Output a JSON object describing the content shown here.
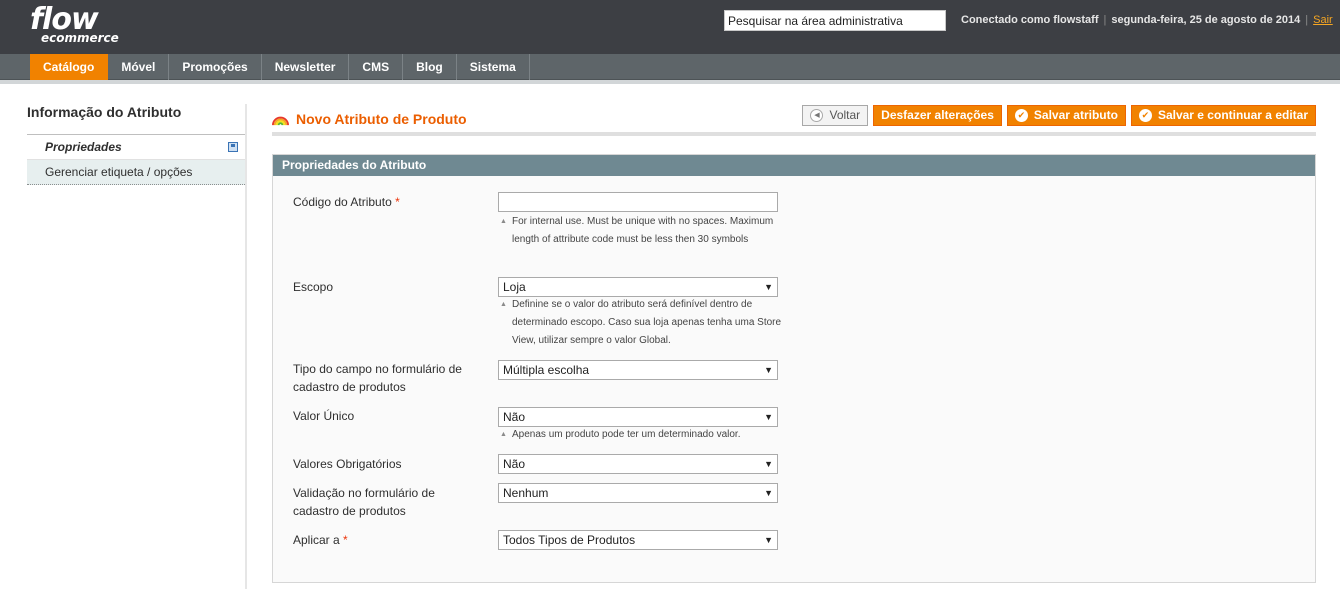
{
  "header": {
    "logo_line1": "flow",
    "logo_line2": "ecommerce",
    "search_value": "Pesquisar na área administrativa",
    "logged_in": "Conectado como flowstaff",
    "date": "segunda-feira, 25 de agosto de 2014",
    "logout": "Sair"
  },
  "nav": {
    "items": [
      "Catálogo",
      "Móvel",
      "Promoções",
      "Newsletter",
      "CMS",
      "Blog",
      "Sistema"
    ]
  },
  "sidebar": {
    "title": "Informação do Atributo",
    "tabs": [
      "Propriedades",
      "Gerenciar etiqueta / opções"
    ]
  },
  "page": {
    "title": "Novo Atributo de Produto",
    "buttons": {
      "back": "Voltar",
      "reset": "Desfazer alterações",
      "save": "Salvar atributo",
      "save_continue": "Salvar e continuar a editar"
    }
  },
  "fieldset": {
    "title": "Propriedades do Atributo",
    "code": {
      "label": "Código do Atributo",
      "req": "*",
      "value": "",
      "note": "For internal use. Must be unique with no spaces. Maximum length of attribute code must be less then 30 symbols"
    },
    "scope": {
      "label": "Escopo",
      "value": "Loja",
      "note": "Definine se o valor do atributo será definível dentro de determinado escopo. Caso sua loja apenas tenha uma Store View, utilizar sempre o valor Global."
    },
    "input_type": {
      "label": "Tipo do campo no formulário de cadastro de produtos",
      "value": "Múltipla escolha"
    },
    "unique": {
      "label": "Valor Único",
      "value": "Não",
      "note": "Apenas um produto pode ter um determinado valor."
    },
    "required": {
      "label": "Valores Obrigatórios",
      "value": "Não"
    },
    "validation": {
      "label": "Validação no formulário de cadastro de produtos",
      "value": "Nenhum"
    },
    "apply_to": {
      "label": "Aplicar a",
      "req": "*",
      "value": "Todos Tipos de Produtos"
    }
  },
  "colors": {
    "header_bg": "#3d3f44",
    "nav_bg": "#5e6569",
    "accent": "#f18200",
    "title": "#eb5e00",
    "fieldset_head": "#6f8992"
  }
}
